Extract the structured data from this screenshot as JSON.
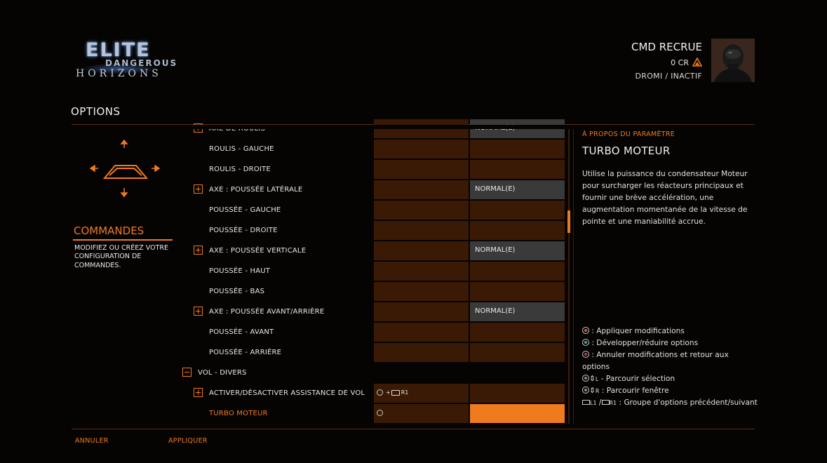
{
  "header": {
    "logo": {
      "line1": "ELITE",
      "line2": "DANGEROUS",
      "line3": "HORIZONS"
    },
    "commander": {
      "name": "CMD RECRUE",
      "credits": "0 CR",
      "location": "DROMI / INACTIF"
    },
    "page_title": "OPTIONS"
  },
  "left_panel": {
    "section_title": "COMMANDES",
    "section_description": "MODIFIEZ OU CRÉEZ VOTRE CONFIGURATION DE COMMANDES."
  },
  "bindings": [
    {
      "label": "AXE DE ROULIS",
      "kind": "axis",
      "primary": "",
      "secondary": "NORMAL(E)"
    },
    {
      "label": "ROULIS - GAUCHE",
      "kind": "item",
      "primary": "",
      "secondary": ""
    },
    {
      "label": "ROULIS - DROITE",
      "kind": "item",
      "primary": "",
      "secondary": ""
    },
    {
      "label": "AXE : POUSSÉE LATÉRALE",
      "kind": "axis",
      "primary": "",
      "secondary": "NORMAL(E)"
    },
    {
      "label": "POUSSÉE - GAUCHE",
      "kind": "item",
      "primary": "",
      "secondary": ""
    },
    {
      "label": "POUSSÉE - DROITE",
      "kind": "item",
      "primary": "",
      "secondary": ""
    },
    {
      "label": "AXE : POUSSÉE VERTICALE",
      "kind": "axis",
      "primary": "",
      "secondary": "NORMAL(E)"
    },
    {
      "label": "POUSSÉE - HAUT",
      "kind": "item",
      "primary": "",
      "secondary": ""
    },
    {
      "label": "POUSSÉE - BAS",
      "kind": "item",
      "primary": "",
      "secondary": ""
    },
    {
      "label": "AXE : POUSSÉE AVANT/ARRIÈRE",
      "kind": "axis",
      "primary": "",
      "secondary": "NORMAL(E)"
    },
    {
      "label": "POUSSÉE - AVANT",
      "kind": "item",
      "primary": "",
      "secondary": ""
    },
    {
      "label": "POUSSÉE - ARRIÈRE",
      "kind": "item",
      "primary": "",
      "secondary": ""
    },
    {
      "label": "VOL - DIVERS",
      "kind": "group",
      "primary": "",
      "secondary": ""
    },
    {
      "label": "ACTIVER/DÉSACTIVER ASSISTANCE DE VOL",
      "kind": "toggle",
      "primary": "+ R1",
      "secondary": ""
    },
    {
      "label": "TURBO MOTEUR",
      "kind": "selected",
      "primary": "",
      "secondary": ""
    }
  ],
  "info_panel": {
    "about_label": "À PROPOS DU PARAMÈTRE",
    "title": "TURBO MOTEUR",
    "description": "Utilise la puissance du condensateur Moteur pour surcharger les réacteurs principaux et fournir une brève accélération, une augmentation momentanée de la vitesse de pointe et une maniabilité accrue.",
    "help": {
      "apply": ": Appliquer modifications",
      "expand": ": Développer/réduire options",
      "cancel": ": Annuler modifications et retour aux options",
      "browse_selection_key": "L",
      "browse_selection": "- Parcourir sélection",
      "browse_window_key": "R",
      "browse_window": ": Parcourir fenêtre",
      "group_key_l": "L1",
      "group_key_r": "R1",
      "group_sep": "/",
      "group": ": Groupe d'options précédent/suivant"
    }
  },
  "footer": {
    "cancel": "ANNULER",
    "apply": "APPLIQUER"
  },
  "colors": {
    "accent": "#f07a1e",
    "cell": "#3a1a05",
    "axis_cell": "#3a3a3a",
    "background": "#050403"
  },
  "scroll": {
    "position_fraction": 0.3
  }
}
